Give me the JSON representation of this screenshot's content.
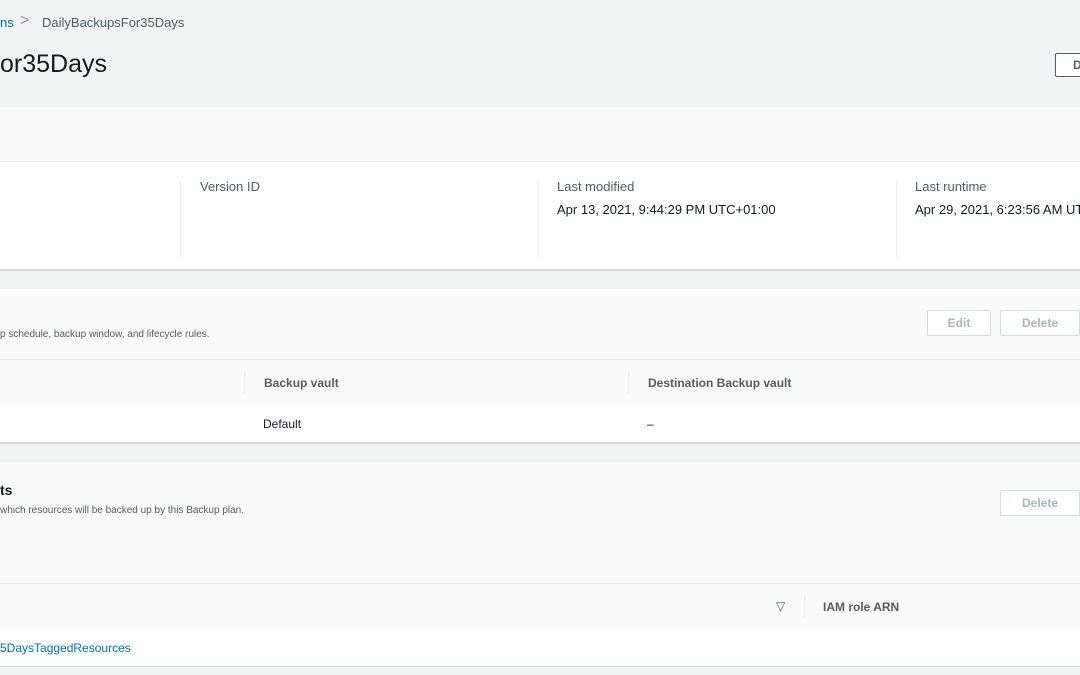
{
  "breadcrumb": {
    "parent_label": "ns",
    "separator": ">",
    "current": "DailyBackupsFor35Days"
  },
  "page": {
    "title": "or35Days",
    "action_button_label": "D"
  },
  "summary": {
    "version_id_label": "Version ID",
    "version_id_value": "",
    "last_modified_label": "Last modified",
    "last_modified_value": "Apr 13, 2021, 9:44:29 PM UTC+01:00",
    "last_runtime_label": "Last runtime",
    "last_runtime_value": "Apr 29, 2021, 6:23:56 AM UT"
  },
  "backup_rules": {
    "description": "p schedule, backup window, and lifecycle rules.",
    "edit_label": "Edit",
    "delete_label": "Delete",
    "columns": [
      "Backup vault",
      "Destination Backup vault"
    ],
    "rows": [
      {
        "backup_vault": "Default",
        "destination_vault": "–"
      }
    ]
  },
  "resource_assignments": {
    "title": "ts",
    "description": "which resources will be backed up by this Backup plan.",
    "delete_label": "Delete",
    "sort_icon": "▽",
    "columns": [
      "IAM role ARN"
    ],
    "rows": [
      {
        "name": "5DaysTaggedResources"
      }
    ]
  },
  "colors": {
    "link": "#0073bb",
    "background": "#f2f3f3",
    "panel": "#ffffff",
    "border": "#d5dbdb"
  }
}
